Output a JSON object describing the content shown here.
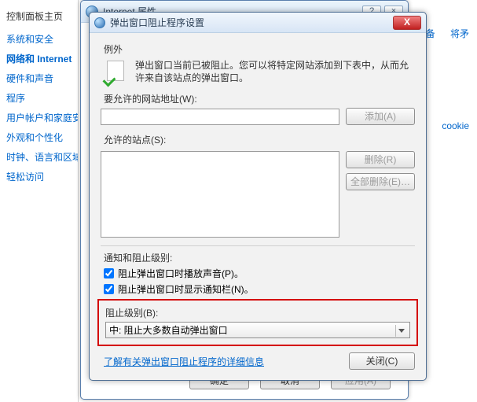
{
  "cp": {
    "home": "控制面板主页",
    "links": [
      "系统和安全",
      "网络和 Internet",
      "硬件和声音",
      "程序",
      "用户帐户和家庭安",
      "外观和个性化",
      "时钟、语言和区域",
      "轻松访问"
    ],
    "active_index": 1,
    "right1": "备",
    "right2": "将矛",
    "right3": "cookie"
  },
  "win1": {
    "title": "Internet 属性",
    "help": "?",
    "close": "×",
    "ok": "确定",
    "cancel": "取消",
    "apply": "应用(A)"
  },
  "win2": {
    "title": "弹出窗口阻止程序设置",
    "close": "X",
    "sec_exceptions": "例外",
    "desc": "弹出窗口当前已被阻止。您可以将特定网站添加到下表中，从而允许来自该站点的弹出窗口。",
    "addr_label": "要允许的网站地址(W):",
    "add": "添加(A)",
    "allowed_label": "允许的站点(S):",
    "remove": "删除(R)",
    "remove_all": "全部删除(E)…",
    "notif_label": "通知和阻止级别:",
    "chk_sound": "阻止弹出窗口时播放声音(P)。",
    "chk_bar": "阻止弹出窗口时显示通知栏(N)。",
    "level_label": "阻止级别(B):",
    "level_value": "中: 阻止大多数自动弹出窗口",
    "more_link": "了解有关弹出窗口阻止程序的详细信息",
    "close_btn": "关闭(C)"
  }
}
